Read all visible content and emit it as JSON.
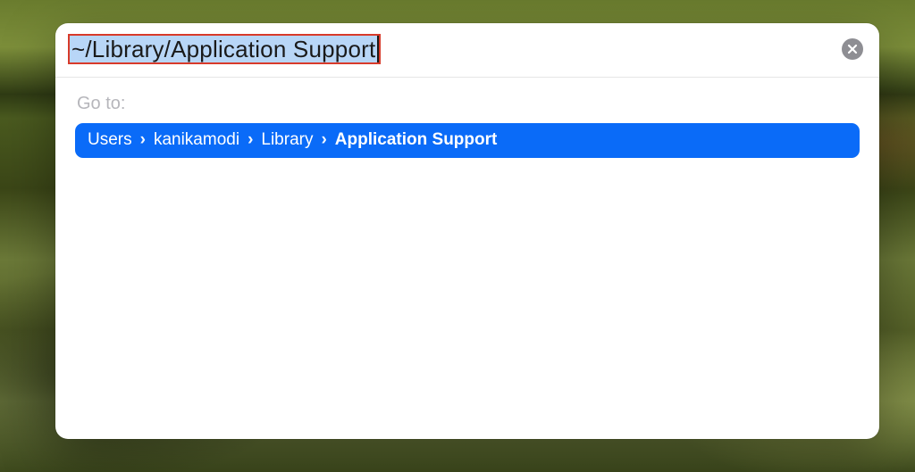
{
  "dialog": {
    "path_input": "~/Library/Application Support",
    "close_icon_name": "close-icon",
    "goto_label": "Go to:",
    "breadcrumb": {
      "segments": [
        "Users",
        "kanikamodi",
        "Library",
        "Application Support"
      ],
      "separator": "›"
    }
  },
  "colors": {
    "selection_bg": "#b8d6f7",
    "breadcrumb_bg": "#0a6bf8",
    "highlight_border": "#d83a2a",
    "close_btn": "#8e8e93"
  }
}
